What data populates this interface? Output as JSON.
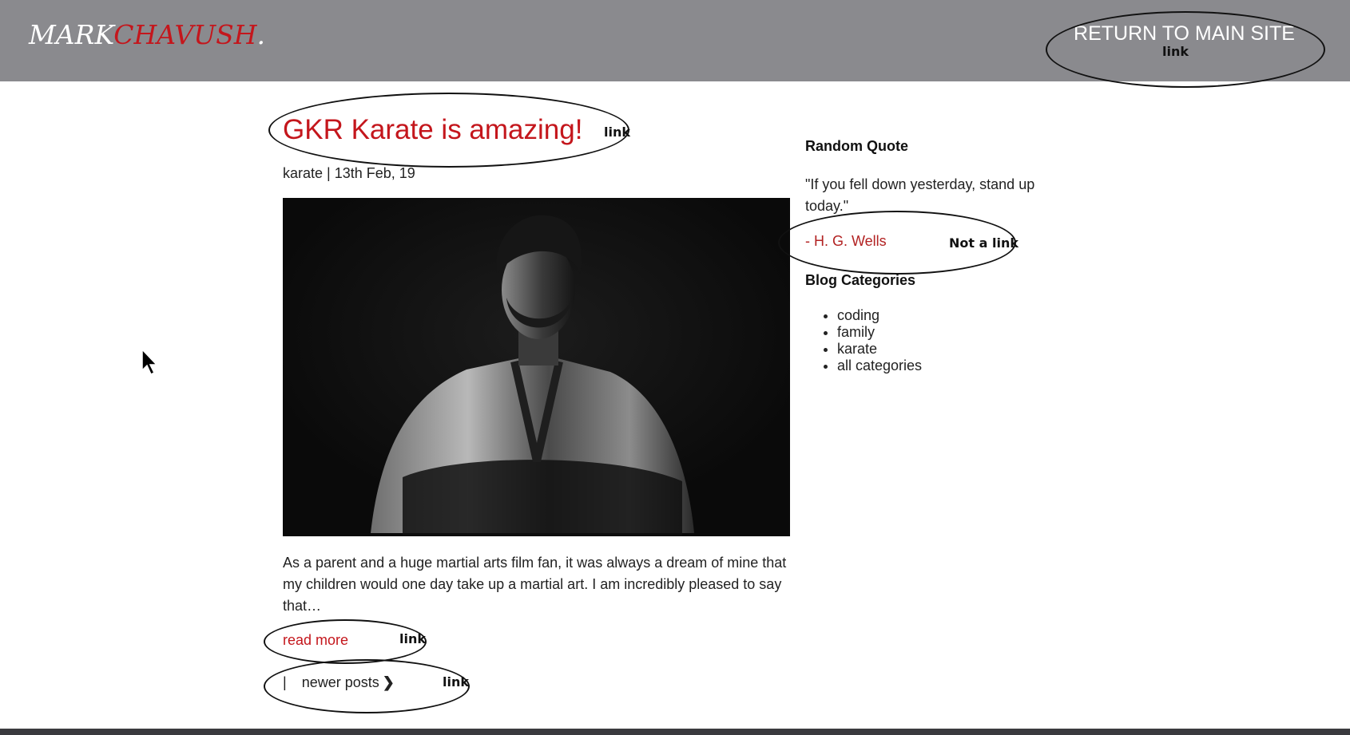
{
  "header": {
    "logo_first": "MARK",
    "logo_last": "CHAVUSH",
    "logo_dot": ".",
    "return_link": "RETURN TO MAIN SITE"
  },
  "post": {
    "title": "GKR Karate is amazing!",
    "meta": "karate | 13th Feb, 19",
    "excerpt": "As a parent and a huge martial arts film fan, it was always a dream of mine that my children would one day take up a martial art. I am incredibly pleased to say that…",
    "read_more": "read more"
  },
  "pagination": {
    "separator": "|",
    "newer_posts": "newer posts"
  },
  "sidebar": {
    "quote_heading": "Random Quote",
    "quote_text": "\"If you fell down yesterday, stand up today.\"",
    "quote_author": "- H. G. Wells",
    "categories_heading": "Blog Categories",
    "categories": [
      "coding",
      "family",
      "karate",
      "all categories"
    ]
  },
  "annotations": {
    "return_link_label": "link",
    "title_label": "link",
    "author_label": "Not a link",
    "read_more_label": "link",
    "newer_posts_label": "link"
  },
  "colors": {
    "header_bg": "#8a8a8e",
    "accent_red": "#c4161c",
    "footer_bg": "#3a3a3e"
  }
}
